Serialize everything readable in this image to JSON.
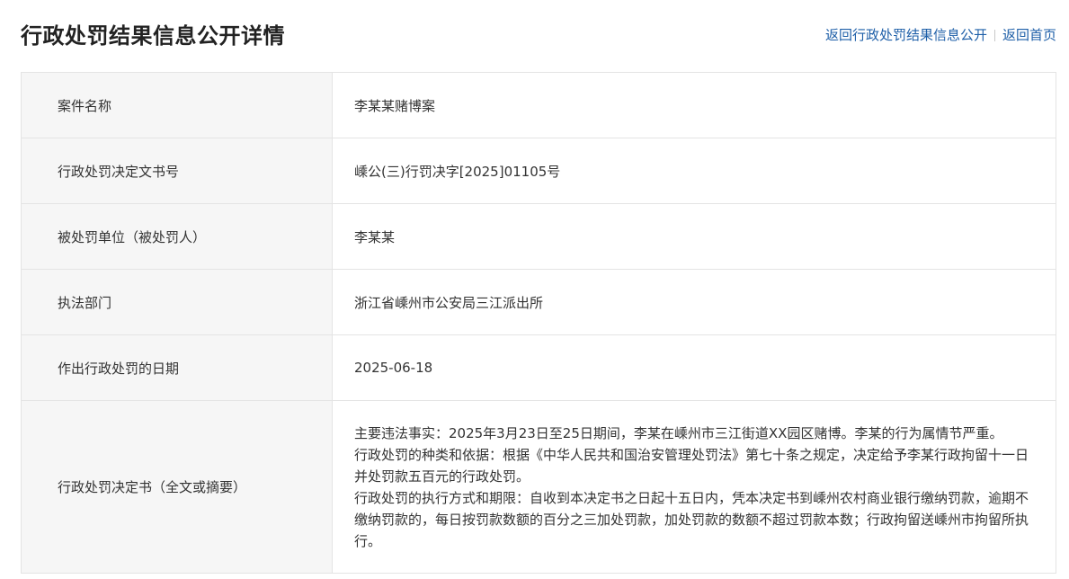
{
  "header": {
    "title": "行政处罚结果信息公开详情",
    "link_back_list": "返回行政处罚结果信息公开",
    "link_home": "返回首页"
  },
  "rows": [
    {
      "label": "案件名称",
      "value": "李某某赌博案"
    },
    {
      "label": "行政处罚决定文书号",
      "value": "嵊公(三)行罚决字[2025]01105号"
    },
    {
      "label": "被处罚单位（被处罚人）",
      "value": "李某某"
    },
    {
      "label": "执法部门",
      "value": "浙江省嵊州市公安局三江派出所"
    },
    {
      "label": "作出行政处罚的日期",
      "value": "2025-06-18"
    }
  ],
  "decision": {
    "label": "行政处罚决定书（全文或摘要）",
    "paragraphs": [
      "主要违法事实：2025年3月23日至25日期间，李某在嵊州市三江街道XX园区赌博。李某的行为属情节严重。",
      "行政处罚的种类和依据：根据《中华人民共和国治安管理处罚法》第七十条之规定，决定给予李某行政拘留十一日并处罚款五百元的行政处罚。",
      "行政处罚的执行方式和期限：自收到本决定书之日起十五日内，凭本决定书到嵊州农村商业银行缴纳罚款，逾期不缴纳罚款的，每日按罚款数额的百分之三加处罚款，加处罚款的数额不超过罚款本数；行政拘留送嵊州市拘留所执行。"
    ]
  },
  "colors": {
    "link": "#1e5fa8",
    "label_bg": "#f6f6f6",
    "border": "#e4e4e4"
  }
}
